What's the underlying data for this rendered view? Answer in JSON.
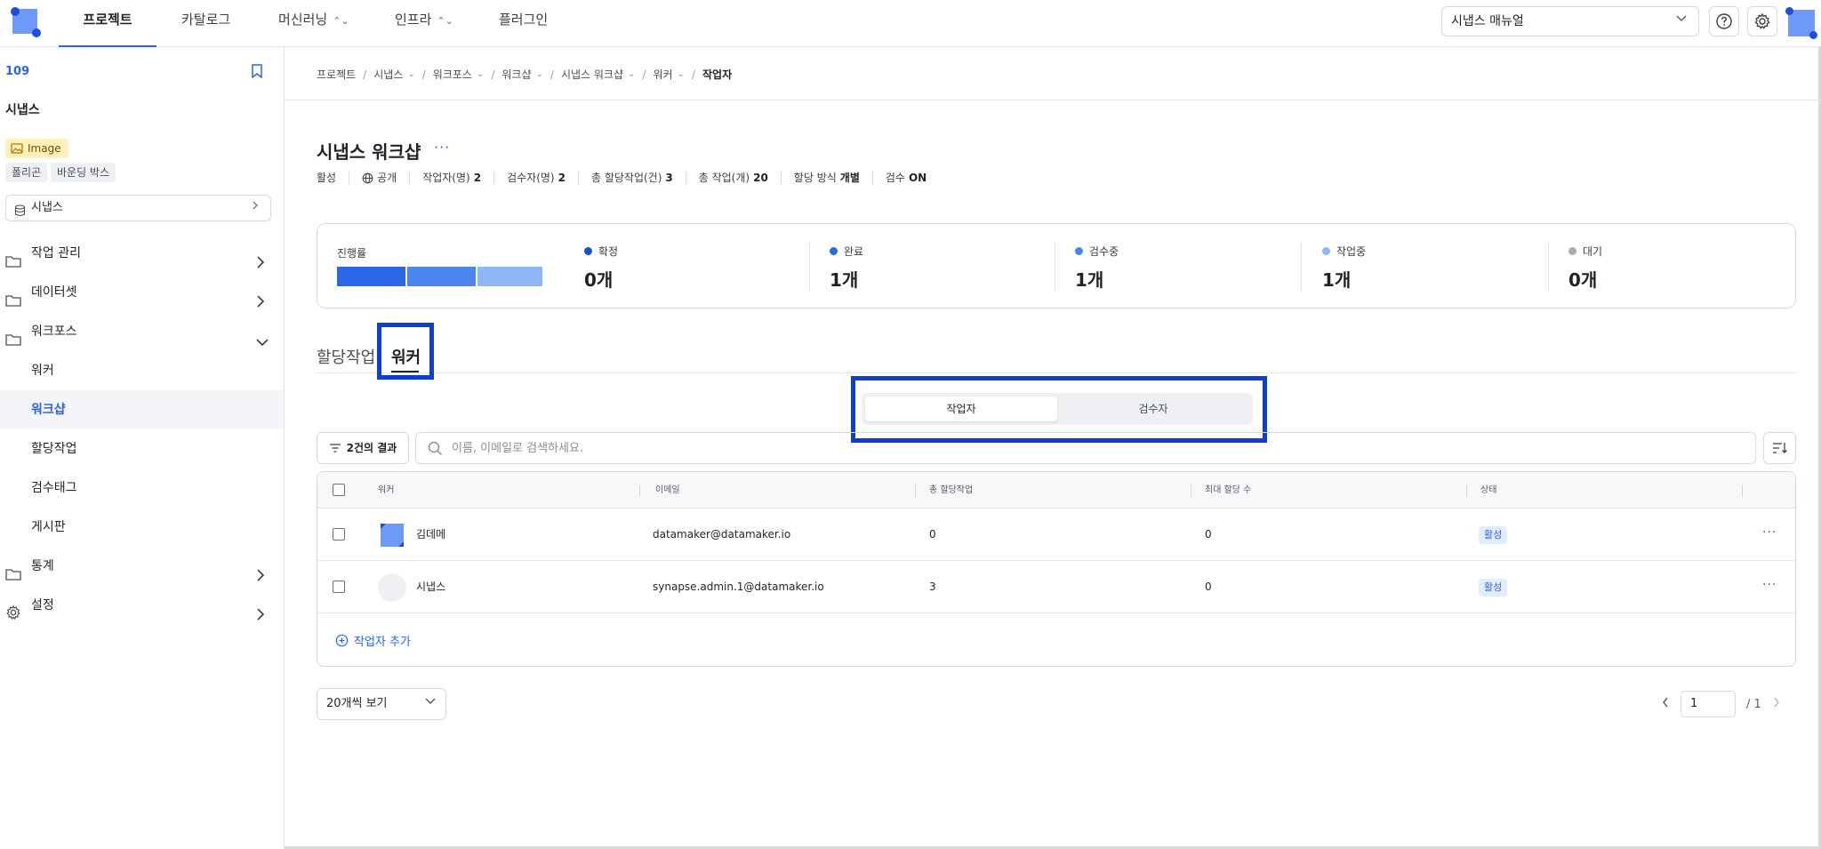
{
  "topnav": {
    "tabs": [
      {
        "label": "프로젝트",
        "has_chevron": false,
        "active": true
      },
      {
        "label": "카탈로그",
        "has_chevron": false,
        "active": false
      },
      {
        "label": "머신러닝",
        "has_chevron": true,
        "active": false
      },
      {
        "label": "인프라",
        "has_chevron": true,
        "active": false
      },
      {
        "label": "플러그인",
        "has_chevron": false,
        "active": false
      }
    ],
    "manual_select": "시냅스 매뉴얼",
    "icons": [
      "help-icon",
      "gear-icon"
    ]
  },
  "sidebar": {
    "project_id": "109",
    "project_name": "시냅스",
    "data_type_badge": "Image",
    "tags": [
      "폴리곤",
      "바운딩 박스"
    ],
    "dataset_select": "시냅스",
    "menu": {
      "work_management": "작업 관리",
      "dataset": "데이터셋",
      "workforce": "워크포스",
      "stats": "통계",
      "settings": "설정"
    },
    "workforce_items": [
      "워커",
      "워크샵",
      "할당작업",
      "검수태그",
      "게시판"
    ],
    "active_item": "워크샵"
  },
  "breadcrumb": [
    {
      "label": "프로젝트",
      "dropdown": false
    },
    {
      "label": "시냅스",
      "dropdown": true
    },
    {
      "label": "워크포스",
      "dropdown": true
    },
    {
      "label": "워크샵",
      "dropdown": true
    },
    {
      "label": "시냅스 워크샵",
      "dropdown": true
    },
    {
      "label": "워커",
      "dropdown": true
    },
    {
      "label": "작업자",
      "dropdown": false
    }
  ],
  "page": {
    "title": "시냅스 워크샵",
    "more": "···",
    "meta": {
      "status": "활성",
      "visibility": "공개",
      "workers_label": "작업자(명)",
      "workers_value": "2",
      "reviewers_label": "검수자(명)",
      "reviewers_value": "2",
      "assigned_label": "총 할당작업(건)",
      "assigned_value": "3",
      "tasks_label": "총 작업(개)",
      "tasks_value": "20",
      "method_label": "할당 방식",
      "method_value": "개별",
      "review_label": "검수",
      "review_value": "ON"
    }
  },
  "progress": {
    "label": "진행률",
    "segments": [
      {
        "fraction": 0.25,
        "color": "#2a66e6"
      },
      {
        "fraction": 0.25,
        "color": "#4a86ee"
      },
      {
        "fraction": 0.25,
        "color": "#8db8f5"
      }
    ],
    "stats": [
      {
        "label": "확정",
        "value": "0개",
        "color": "#1c4fd7"
      },
      {
        "label": "완료",
        "value": "1개",
        "color": "#2a66e6"
      },
      {
        "label": "검수중",
        "value": "1개",
        "color": "#4a86ee"
      },
      {
        "label": "작업중",
        "value": "1개",
        "color": "#8db8f5"
      },
      {
        "label": "대기",
        "value": "0개",
        "color": "#a8adb4"
      }
    ]
  },
  "tabs": {
    "assign": "할당작업",
    "worker": "워커"
  },
  "segment": {
    "option_worker": "작업자",
    "option_reviewer": "검수자"
  },
  "filter": {
    "result_label": "2건의 결과",
    "search_placeholder": "이름, 이메일로 검색하세요."
  },
  "table": {
    "headers": {
      "worker": "워커",
      "email": "이메일",
      "total_assigned": "총 할당작업",
      "max_assign": "최대 할당 수",
      "status": "상태"
    },
    "rows": [
      {
        "name": "김데메",
        "email": "datamaker@datamaker.io",
        "total_assigned": "0",
        "max_assign": "0",
        "status": "활성",
        "avatar": "logo"
      },
      {
        "name": "시냅스",
        "email": "synapse.admin.1@datamaker.io",
        "total_assigned": "3",
        "max_assign": "0",
        "status": "활성",
        "avatar": "empty"
      }
    ],
    "add_label": "작업자 추가"
  },
  "pagination": {
    "page_size": "20개씩 보기",
    "current_page": "1",
    "total_pages": "/ 1"
  }
}
